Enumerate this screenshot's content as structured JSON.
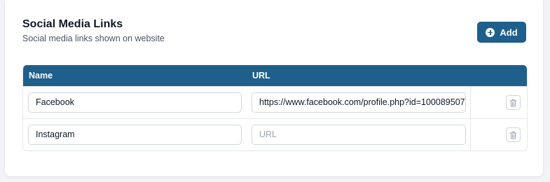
{
  "section": {
    "title": "Social Media Links",
    "subtitle": "Social media links shown on website",
    "add_label": "Add",
    "add_icon": "plus-circle-icon"
  },
  "table": {
    "headers": {
      "name": "Name",
      "url": "URL"
    },
    "rows": [
      {
        "name": "Facebook",
        "url": "https://www.facebook.com/profile.php?id=100089507",
        "url_placeholder": "URL",
        "delete_icon": "trash-icon"
      },
      {
        "name": "Instagram",
        "url": "",
        "url_placeholder": "URL",
        "delete_icon": "trash-icon"
      }
    ]
  },
  "colors": {
    "accent": "#1f5f8b",
    "border": "#d1d5db"
  }
}
